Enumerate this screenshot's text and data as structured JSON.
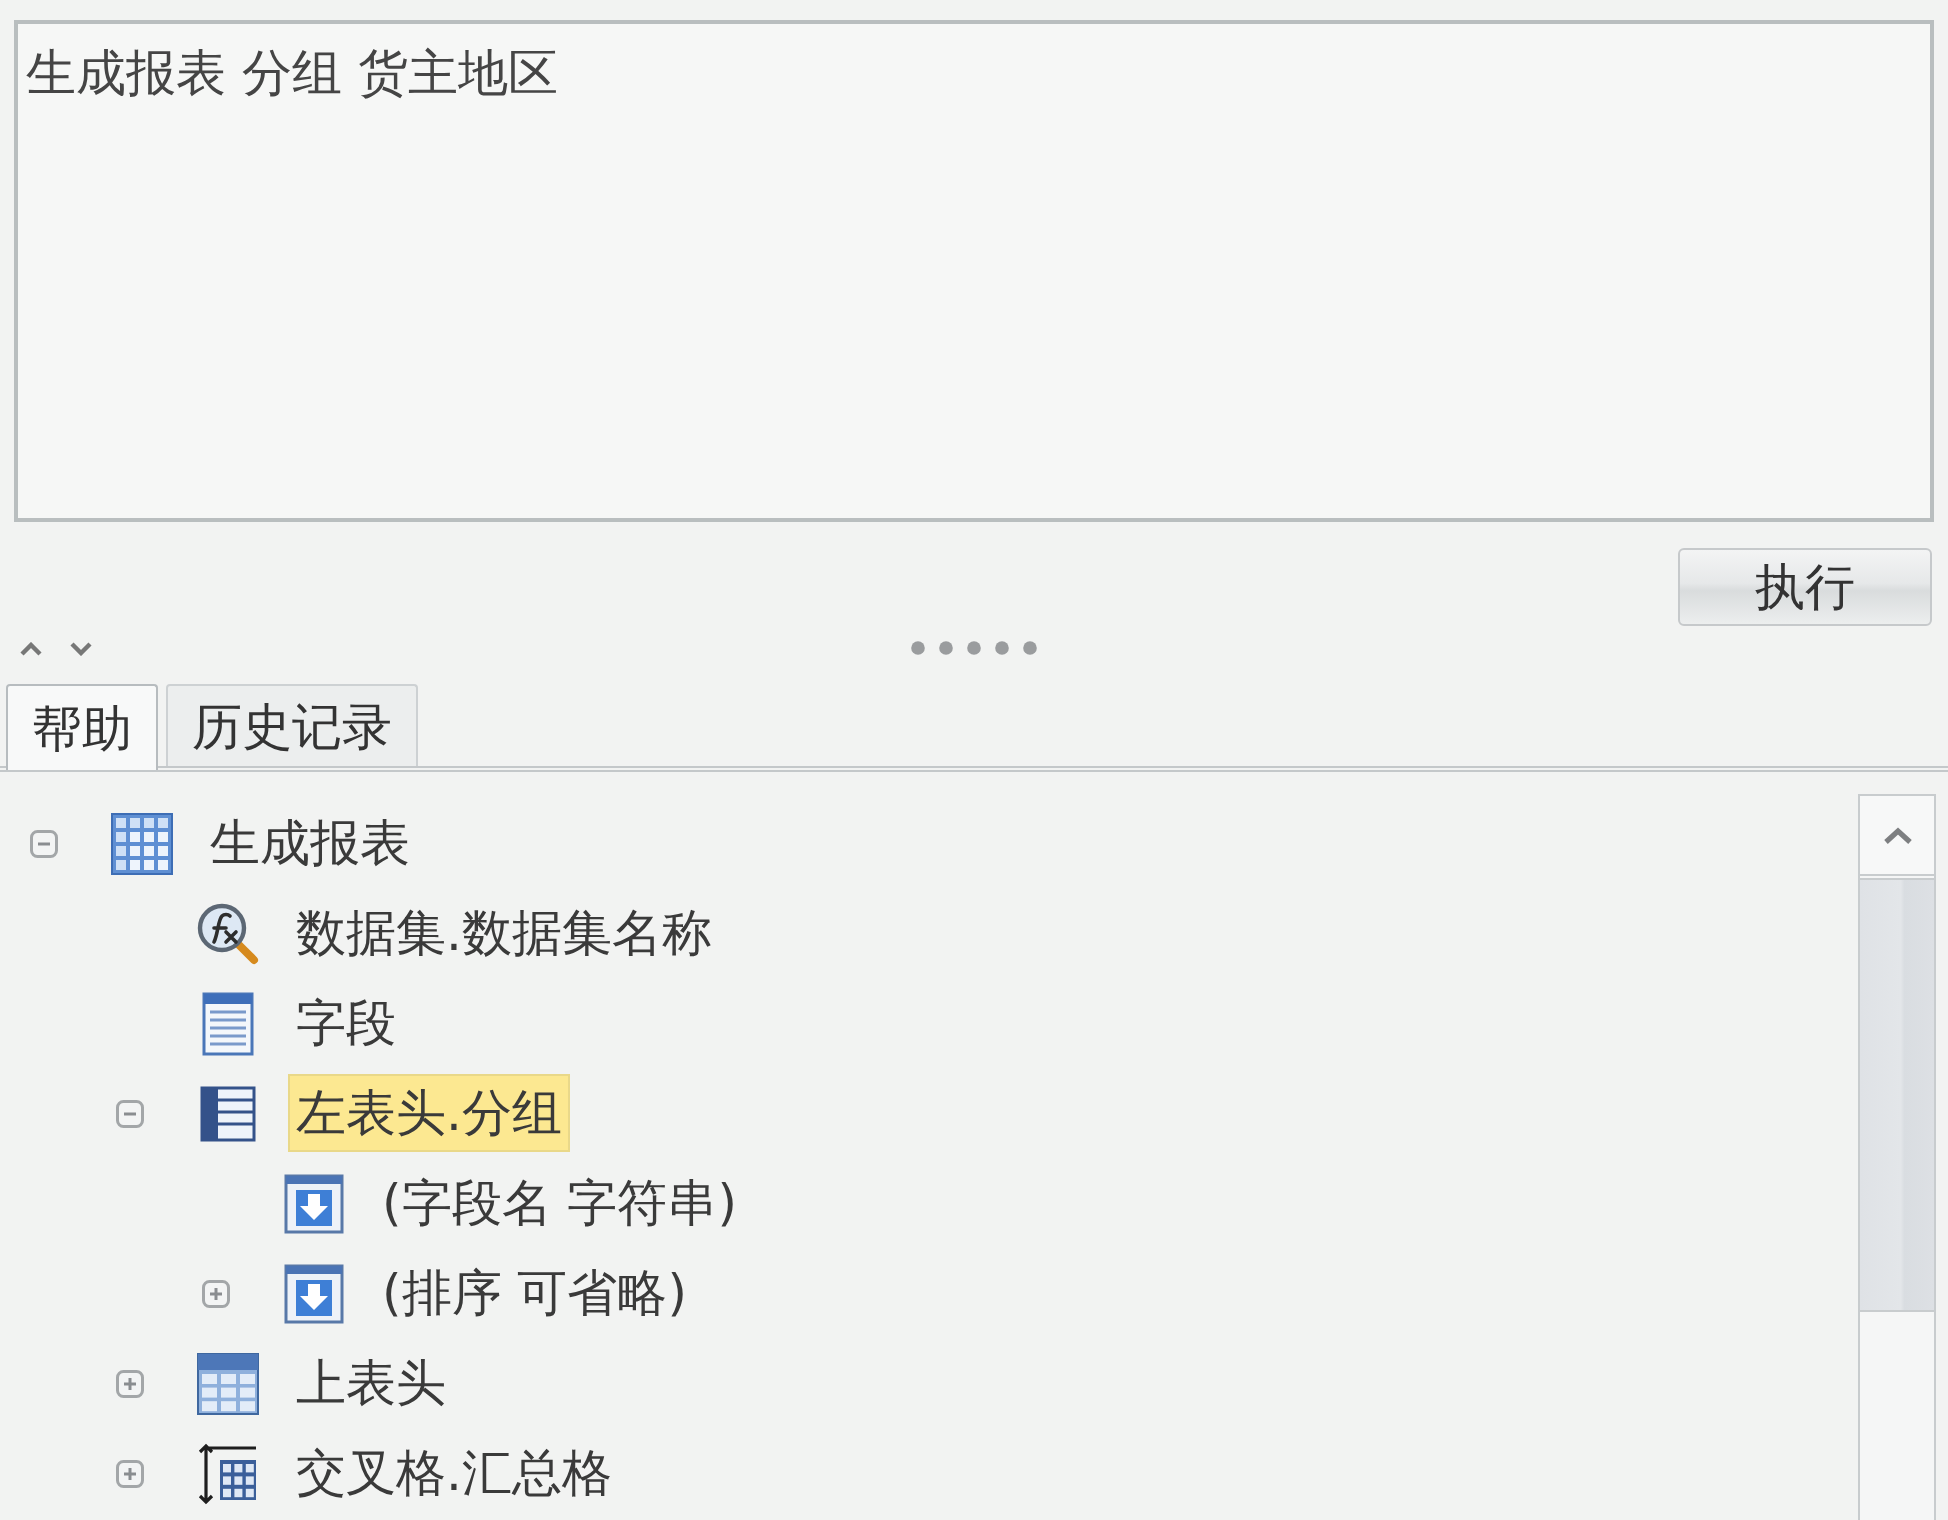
{
  "query_editor": {
    "value": "生成报表 分组 货主地区"
  },
  "execute_button": {
    "label": "执行"
  },
  "tabs": [
    {
      "label": "帮助",
      "selected": true
    },
    {
      "label": "历史记录",
      "selected": false
    }
  ],
  "tree": {
    "items": [
      {
        "label": "生成报表",
        "kind": "grid",
        "expanded": true,
        "selected": false,
        "children": [
          {
            "label": "数据集.数据集名称",
            "kind": "function",
            "selected": false
          },
          {
            "label": "字段",
            "kind": "list",
            "selected": false
          },
          {
            "label": "左表头.分组",
            "kind": "rows",
            "expanded": true,
            "selected": true,
            "children": [
              {
                "label": "(字段名 字符串)",
                "kind": "arrow",
                "selected": false
              },
              {
                "label": "(排序 可省略)",
                "kind": "arrow",
                "expanded": false,
                "selected": false
              }
            ]
          },
          {
            "label": "上表头",
            "kind": "header",
            "expanded": false,
            "selected": false
          },
          {
            "label": "交叉格.汇总格",
            "kind": "cross",
            "expanded": false,
            "selected": false
          }
        ]
      }
    ]
  }
}
